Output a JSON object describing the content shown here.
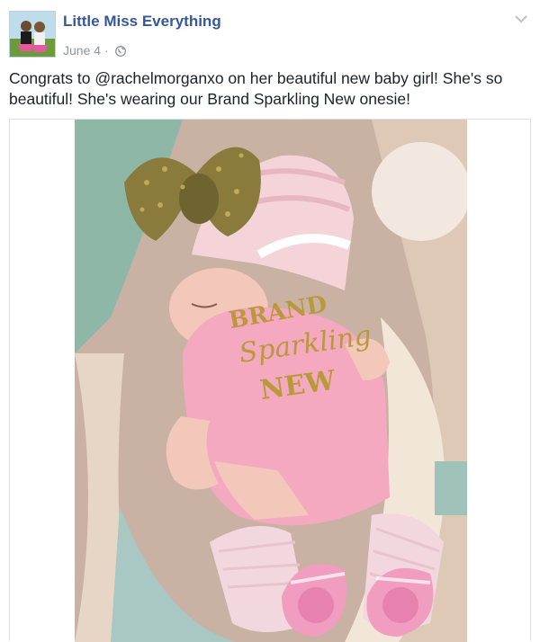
{
  "post": {
    "page_name": "Little Miss Everything",
    "date": "June 4",
    "separator": "·",
    "audience_icon": "globe-icon",
    "menu_icon": "chevron-down-icon",
    "message": "Congrats to @rachelmorganxo on her beautiful new baby girl! She's so beautiful! She's wearing our Brand Sparkling New onesie!",
    "photo": {
      "description": "newborn in pink onesie with gold sequin bow, knit hat, crocheted leg warmers and pink ruffle socks",
      "onesie_text": [
        "BRAND",
        "Sparkling",
        "NEW"
      ]
    }
  },
  "colors": {
    "link": "#365899",
    "meta": "#90949c",
    "text": "#1d2129",
    "onesie_pink": "#f4a9c0",
    "sequin_gold": "#8a7a3c"
  }
}
